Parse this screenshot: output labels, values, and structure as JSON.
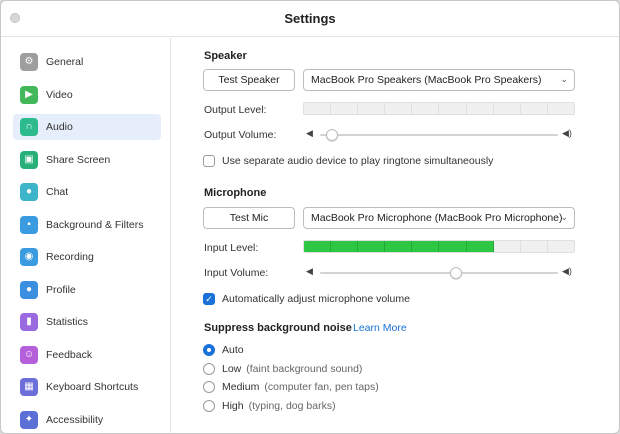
{
  "window": {
    "title": "Settings"
  },
  "sidebar": {
    "active_index": 2,
    "items": [
      {
        "label": "General",
        "icon": "gear-icon",
        "color": "#9e9e9e"
      },
      {
        "label": "Video",
        "icon": "video-camera-icon",
        "color": "#42b85a"
      },
      {
        "label": "Audio",
        "icon": "headphones-icon",
        "color": "#2dba8c"
      },
      {
        "label": "Share Screen",
        "icon": "share-screen-icon",
        "color": "#27b07a"
      },
      {
        "label": "Chat",
        "icon": "chat-bubble-icon",
        "color": "#3bb5c7"
      },
      {
        "label": "Background & Filters",
        "icon": "background-icon",
        "color": "#3a9be0"
      },
      {
        "label": "Recording",
        "icon": "recording-icon",
        "color": "#3a9be0"
      },
      {
        "label": "Profile",
        "icon": "profile-icon",
        "color": "#3a8fe0"
      },
      {
        "label": "Statistics",
        "icon": "statistics-icon",
        "color": "#9a6ae0"
      },
      {
        "label": "Feedback",
        "icon": "feedback-icon",
        "color": "#b65fdb"
      },
      {
        "label": "Keyboard Shortcuts",
        "icon": "keyboard-icon",
        "color": "#6d6fd8"
      },
      {
        "label": "Accessibility",
        "icon": "accessibility-icon",
        "color": "#5c6fd6"
      }
    ]
  },
  "speaker": {
    "section_title": "Speaker",
    "test_button": "Test Speaker",
    "device_selected": "MacBook Pro Speakers (MacBook Pro Speakers)",
    "output_level_label": "Output Level:",
    "output_level_fraction": 0.0,
    "output_volume_label": "Output Volume:",
    "output_volume_fraction": 0.0,
    "ringtone_checkbox_label": "Use separate audio device to play ringtone simultaneously",
    "ringtone_checked": false
  },
  "microphone": {
    "section_title": "Microphone",
    "test_button": "Test Mic",
    "device_selected": "MacBook Pro Microphone (MacBook Pro Microphone)",
    "input_level_label": "Input Level:",
    "input_level_fraction": 0.7,
    "input_volume_label": "Input Volume:",
    "input_volume_fraction": 0.55,
    "auto_adjust_label": "Automatically adjust microphone volume",
    "auto_adjust_checked": true
  },
  "noise": {
    "section_title": "Suppress background noise",
    "learn_more": "Learn More",
    "selected_index": 0,
    "options": [
      {
        "label": "Auto",
        "hint": ""
      },
      {
        "label": "Low",
        "hint": "(faint background sound)"
      },
      {
        "label": "Medium",
        "hint": "(computer fan, pen taps)"
      },
      {
        "label": "High",
        "hint": "(typing, dog barks)"
      }
    ]
  },
  "accent_color": "#1a72d8",
  "meter_on_color": "#2ec744"
}
